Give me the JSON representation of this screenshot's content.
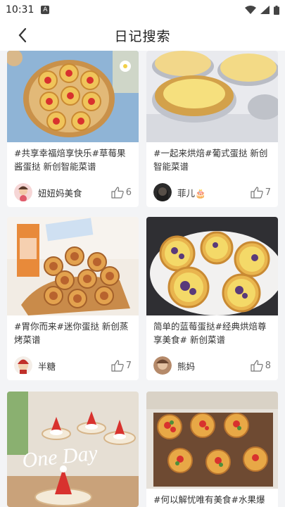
{
  "status": {
    "time": "10:31",
    "notification_glyph": "A"
  },
  "header": {
    "title": "日记搜索"
  },
  "cards": [
    {
      "text": "#共享幸福焙享快乐#草莓果酱蛋挞 新创智能菜谱",
      "author": "妞妞妈美食",
      "likes": "6"
    },
    {
      "text": "#一起来烘焙#葡式蛋挞 新创智能菜谱",
      "author": "菲儿🎂",
      "likes": "7"
    },
    {
      "text": "#胃你而来#迷你蛋挞 新创蒸烤菜谱",
      "author": "半糖",
      "likes": "7"
    },
    {
      "text": "简单的蓝莓蛋挞#经典烘焙尊享美食# 新创菜谱",
      "author": "熊妈",
      "likes": "8"
    },
    {
      "image_text": "One Day"
    },
    {
      "text": "#何以解忧唯有美食#水果爆"
    }
  ]
}
